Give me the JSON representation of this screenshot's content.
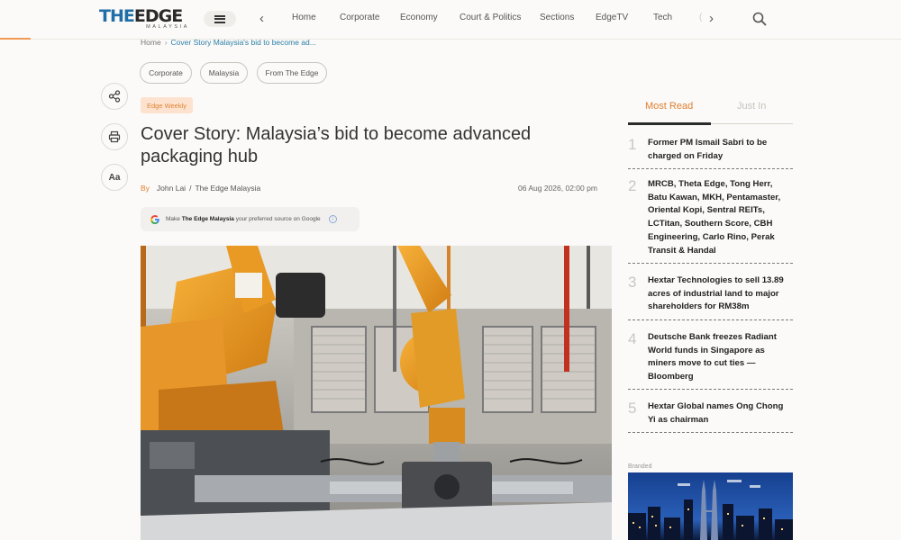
{
  "header": {
    "logo": {
      "the": "THE",
      "edge": "EDGE",
      "sub": "MALAYSIA"
    },
    "nav_items": [
      "Home",
      "Corporate",
      "Economy",
      "Court & Politics",
      "Sections",
      "EdgeTV",
      "Tech"
    ],
    "nav_prev": "‹",
    "nav_next": "›",
    "icons": {
      "menu": "hamburger-icon",
      "search": "search-icon"
    }
  },
  "breadcrumb": {
    "home": "Home",
    "current": "Cover Story  Malaysia's bid to become ad..."
  },
  "tags": [
    "Corporate",
    "Malaysia",
    "From The Edge"
  ],
  "tools": {
    "share": "share-icon",
    "print": "print-icon",
    "font_size": "Aa"
  },
  "article": {
    "badge": "Edge Weekly",
    "title": "Cover Story: Malaysia’s bid to become advanced packaging hub",
    "byline_prefix": "By",
    "author": "John Lai",
    "slash": "/",
    "publication": "The Edge Malaysia",
    "date": "06 Aug 2026, 02:00 pm",
    "google": {
      "prefix": "Make",
      "brand": "The Edge Malaysia",
      "suffix": "your preferred source on Google",
      "info": "i"
    }
  },
  "sidebar": {
    "tabs": {
      "active": "Most Read",
      "inactive": "Just In"
    },
    "most_read": [
      {
        "num": "1",
        "title": "Former PM Ismail Sabri to be charged on Friday"
      },
      {
        "num": "2",
        "title": "MRCB, Theta Edge, Tong Herr, Batu Kawan, MKH, Pentamaster, Oriental Kopi, Sentral REITs, LCTitan, Southern Score, CBH Engineering, Carlo Rino, Perak Transit & Handal"
      },
      {
        "num": "3",
        "title": "Hextar Technologies to sell 13.89 acres of industrial land to major shareholders for RM38m"
      },
      {
        "num": "4",
        "title": "Deutsche Bank freezes Radiant World funds in Singapore as miners move to cut ties — Bloomberg"
      },
      {
        "num": "5",
        "title": "Hextar Global names Ong Chong Yi as chairman"
      }
    ],
    "branded_label": "Branded"
  },
  "colors": {
    "accent": "#e07f31",
    "link": "#2b7fa8",
    "badge_bg": "#fde3cf"
  }
}
